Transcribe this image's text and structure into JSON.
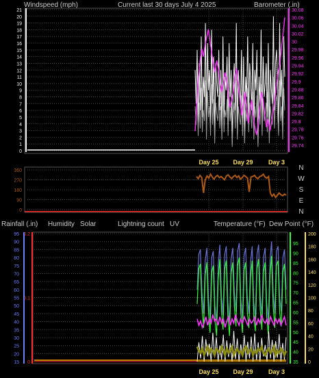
{
  "colors": {
    "bg": "#000000",
    "panel": "#000000",
    "grid": "#4a4a4a",
    "axis_white": "#ffffff",
    "baro": "#ff33ff",
    "wind": "#ffffff",
    "wind_avg": "#9a9a9a",
    "winddir": "#b05a12",
    "rain_axis": "#6f7dff",
    "rainfall": "#ff2a2a",
    "humidity": "#6a74d8",
    "solar": "#ffffff",
    "lightning": "#ffaa00",
    "uv": "#ffaa00",
    "temp": "#ff33ff",
    "dewpoint": "#8c8c12",
    "temp_axis": "#33ff33",
    "dew_axis": "#ffe25a"
  },
  "header": {
    "title": "Current last 30 days July 4 2025",
    "windspeed_label": "Windspeed (mph)",
    "barometer_label": "Barometer (.in)",
    "rainfall_label": "Rainfall (.in)",
    "humidity_label": "Humidity",
    "solar_label": "Solar",
    "lightning_label": "Lightning count",
    "uv_label": "UV",
    "temperature_label": "Temperature (°F)",
    "dewpoint_label": "Dew Point (°F)"
  },
  "compass": [
    "N",
    "W",
    "S",
    "E",
    "N"
  ],
  "chart_data": [
    {
      "type": "line",
      "x_labels": [
        "Day 25",
        "Day 29",
        "Day 3"
      ],
      "series": [
        {
          "name": "Windspeed (mph)",
          "axis": "left",
          "ylim": [
            0,
            21
          ],
          "ticks": [
            "21",
            "20",
            "19",
            "18",
            "17",
            "16",
            "15",
            "14",
            "13",
            "12",
            "11",
            "10",
            "9",
            "8",
            "7",
            "6",
            "5",
            "4",
            "3",
            "2",
            "1",
            "0"
          ],
          "values": [
            0,
            0,
            0,
            0,
            0,
            0,
            0,
            0,
            0,
            0,
            0,
            0,
            0,
            0,
            0,
            0,
            0,
            0,
            0,
            0,
            0,
            0,
            0,
            0,
            0,
            0,
            0,
            0,
            0,
            0,
            0,
            0,
            0,
            0,
            0,
            0,
            0,
            0,
            0,
            0,
            0,
            0,
            0,
            0,
            0,
            0,
            0,
            0,
            0,
            0,
            0,
            0,
            0,
            0,
            0,
            0,
            0,
            0,
            0,
            0,
            0,
            0,
            0,
            0,
            0,
            0,
            0,
            0,
            0,
            0,
            0,
            0,
            0,
            0,
            0,
            0,
            0,
            0,
            0,
            0,
            0,
            0,
            0,
            0,
            0,
            0,
            0,
            0,
            0,
            0,
            0,
            0,
            0,
            0,
            0,
            0,
            0,
            0,
            0,
            0,
            0,
            0,
            0,
            0,
            0,
            0,
            0,
            0,
            0,
            0,
            0,
            0,
            0,
            0,
            0,
            0,
            0,
            0,
            0,
            0,
            0,
            0,
            0,
            0,
            0,
            0,
            0,
            0,
            0,
            0,
            0,
            0,
            0,
            0,
            0,
            0,
            0,
            0,
            0,
            0,
            0,
            0,
            0,
            0,
            0,
            0,
            0,
            0,
            0,
            0,
            0,
            0,
            0,
            0,
            0,
            0,
            0,
            0,
            0,
            0,
            0,
            0,
            0,
            0,
            0,
            0,
            0,
            0,
            0,
            0,
            0,
            0,
            0,
            0,
            0,
            0,
            0,
            0,
            0,
            0,
            0,
            0,
            0,
            0,
            0,
            0,
            0,
            0,
            0,
            0,
            0,
            0,
            0,
            0,
            0,
            0,
            0,
            0,
            0,
            0,
            0,
            0,
            0,
            0,
            0,
            0,
            0,
            0,
            0,
            0,
            0,
            0,
            0,
            0,
            0,
            0,
            0,
            0,
            0,
            0,
            0,
            0,
            0,
            0,
            0,
            0,
            0,
            0,
            0,
            0,
            0,
            0,
            0,
            0,
            0,
            0,
            0,
            0,
            0,
            0,
            0,
            0,
            0,
            0,
            0,
            0,
            0,
            0,
            0,
            0,
            0,
            0,
            0,
            0,
            0,
            0,
            0,
            0,
            0,
            0,
            0,
            12,
            7,
            15,
            4,
            13,
            6,
            17,
            5,
            11,
            8,
            19,
            3,
            16,
            9,
            12,
            4,
            18,
            7,
            14,
            2,
            13,
            10,
            8,
            15,
            6,
            12,
            3,
            17,
            5,
            11,
            9,
            14,
            4,
            16,
            8,
            12,
            1,
            10,
            13,
            6,
            19,
            3,
            12,
            9,
            7,
            15,
            4,
            14,
            2,
            11,
            8,
            17,
            5,
            13,
            10,
            6,
            16,
            3,
            12,
            9,
            15,
            1,
            11,
            7,
            18,
            4,
            14,
            8,
            10,
            13,
            5,
            16,
            2,
            12,
            9,
            7,
            20,
            6,
            13,
            15,
            10,
            4,
            19,
            8,
            12,
            3,
            17,
            11
          ]
        },
        {
          "name": "Barometer (.in)",
          "axis": "right",
          "ylim": [
            29.73,
            30.09
          ],
          "ticks": [
            "30.08",
            "30.06",
            "30.04",
            "30.02",
            "30",
            "29.98",
            "29.96",
            "29.94",
            "29.92",
            "29.9",
            "29.88",
            "29.86",
            "29.84",
            "29.82",
            "29.8",
            "29.78",
            "29.76",
            "29.74"
          ],
          "values": [
            29.78,
            29.85,
            29.92,
            29.96,
            29.99,
            29.97,
            30.0,
            30.02,
            30.04,
            30.01,
            29.98,
            29.95,
            29.93,
            29.96,
            29.94,
            29.9,
            29.88,
            29.9,
            29.93,
            29.91,
            29.87,
            29.84,
            29.86,
            29.88,
            29.92,
            29.94,
            29.9,
            29.86,
            29.82,
            29.85,
            29.88,
            29.84,
            29.8,
            29.83,
            29.86,
            29.82,
            29.79,
            29.77,
            29.8,
            29.84,
            29.88,
            29.86,
            29.82,
            29.79,
            29.81,
            29.78,
            29.8,
            29.83,
            29.86,
            29.9,
            29.93,
            29.95,
            29.99,
            30.03,
            30.07
          ]
        }
      ]
    },
    {
      "type": "line",
      "x_labels": [],
      "series": [
        {
          "name": "Wind direction",
          "axis": "left",
          "ylim": [
            0,
            360
          ],
          "ticks": [
            "360",
            "270",
            "180",
            "90",
            "0"
          ],
          "values": [
            300,
            280,
            310,
            290,
            150,
            270,
            305,
            285,
            320,
            295,
            275,
            300,
            310,
            290,
            300,
            285,
            270,
            305,
            315,
            295,
            280,
            300,
            310,
            290,
            305,
            275,
            290,
            310,
            300,
            285,
            160,
            295,
            300,
            310,
            290,
            280,
            300,
            305,
            320,
            295,
            285,
            300,
            150,
            120,
            140,
            110,
            130,
            150,
            135,
            125,
            140,
            130
          ]
        }
      ]
    },
    {
      "type": "line",
      "x_labels": [
        "Day 25",
        "Day 29",
        "Day 3"
      ],
      "series": [
        {
          "name": "Humidity",
          "axis": "left",
          "ylim": [
            15,
            95
          ],
          "ticks": [
            "95",
            "90",
            "85",
            "80",
            "75",
            "70",
            "65",
            "60",
            "55",
            "50",
            "45",
            "40",
            "35",
            "30",
            "25",
            "20",
            "15"
          ],
          "values": [
            60,
            82,
            85,
            58,
            45,
            78,
            86,
            55,
            42,
            80,
            84,
            50,
            40,
            75,
            88,
            56,
            44,
            82,
            87,
            52,
            40,
            79,
            86,
            58,
            46,
            84,
            89,
            54,
            42,
            81,
            86,
            55,
            45,
            77,
            87,
            52,
            43,
            82,
            88,
            56,
            44,
            80,
            86,
            52,
            41,
            78,
            90,
            58,
            45,
            84,
            87,
            55,
            46,
            80,
            85,
            60
          ]
        },
        {
          "name": "Rainfall (.in)",
          "axis": "left2",
          "ylim": [
            0,
            0.2
          ],
          "ticks": [
            "0.2",
            "0.1",
            "0"
          ],
          "values": [
            0,
            0,
            0,
            0,
            0,
            0,
            0,
            0,
            0,
            0,
            0,
            0
          ]
        },
        {
          "name": "Solar",
          "axis": "right2",
          "ylim": [
            0,
            200
          ],
          "ticks": [
            "200",
            "180",
            "160",
            "140",
            "120",
            "100",
            "80",
            "60",
            "40",
            "20",
            "0"
          ],
          "values": [
            0,
            30,
            5,
            40,
            0,
            35,
            8,
            28,
            0,
            45,
            6,
            38,
            0,
            25,
            3,
            42,
            0,
            33,
            7,
            29,
            0,
            48,
            4,
            36,
            0,
            27,
            9,
            41,
            0,
            31,
            5,
            39,
            0,
            44,
            2,
            30,
            0,
            37,
            8,
            26,
            0,
            47,
            5,
            34,
            0,
            32,
            6,
            43,
            0,
            29,
            3,
            38
          ]
        },
        {
          "name": "Temperature (°F)",
          "axis": "right",
          "ylim": [
            35,
            95
          ],
          "ticks": [
            "95",
            "90",
            "85",
            "80",
            "75",
            "70",
            "65",
            "60",
            "55",
            "50",
            "45",
            "40",
            "35"
          ],
          "values": [
            55,
            52,
            54,
            51,
            53,
            56,
            52,
            55,
            53,
            57,
            54,
            55,
            52,
            56,
            53,
            55,
            51,
            54,
            56,
            52,
            55,
            53,
            57,
            54,
            52,
            55,
            53,
            56,
            54,
            52,
            55,
            53,
            54,
            56,
            52,
            55,
            53,
            57,
            54,
            53,
            55,
            52,
            56,
            54,
            52,
            55,
            53,
            55,
            52,
            54,
            56,
            52
          ]
        },
        {
          "name": "Dew Point (°F)",
          "axis": "right",
          "ylim": [
            35,
            95
          ],
          "ticks": [],
          "values": [
            42,
            40,
            39,
            41,
            38,
            40,
            42,
            39,
            41,
            40,
            38,
            41,
            40,
            39,
            42,
            40,
            38,
            41,
            39,
            40,
            42,
            38,
            40,
            41,
            39,
            40,
            38,
            41,
            42,
            39,
            40,
            41,
            38,
            40,
            39,
            41,
            40,
            42,
            39,
            38,
            40,
            41,
            39,
            40,
            42,
            38,
            40,
            39,
            41,
            40,
            38,
            40
          ]
        },
        {
          "name": "UV",
          "axis": "right",
          "ylim": [
            0,
            200
          ],
          "ticks": [],
          "values": [
            0,
            0,
            0,
            0,
            0,
            0,
            0,
            0,
            0,
            0,
            0,
            0,
            0,
            0,
            0,
            0,
            0,
            0,
            0,
            0,
            0,
            0,
            0,
            0,
            0,
            0,
            0,
            0,
            0,
            0,
            0,
            0,
            0,
            0,
            0,
            0,
            0,
            0,
            0,
            0,
            0,
            0,
            0,
            0,
            0,
            0,
            0,
            0,
            0,
            0,
            0,
            0,
            0
          ]
        }
      ]
    }
  ]
}
